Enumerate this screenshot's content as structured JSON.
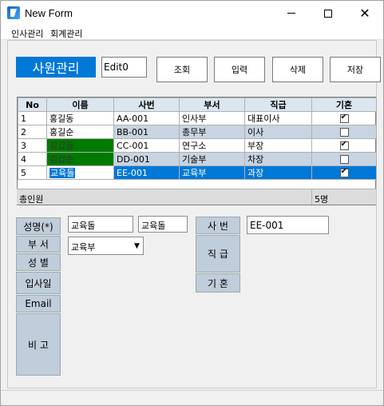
{
  "window": {
    "title": "New Form"
  },
  "menu": [
    "인사관리",
    "회계관리"
  ],
  "header": {
    "label": "사원관리",
    "edit_value": "Edit0"
  },
  "buttons": {
    "search": "조회",
    "input": "입력",
    "delete": "삭제",
    "save": "저장"
  },
  "grid": {
    "columns": [
      "No",
      "이름",
      "사번",
      "부서",
      "직급",
      "기혼"
    ],
    "rows": [
      {
        "no": "1",
        "name": "홍길동",
        "empno": "AA-001",
        "dept": "인사부",
        "rank": "대표이사",
        "married": true
      },
      {
        "no": "2",
        "name": "홍길순",
        "empno": "BB-001",
        "dept": "총무부",
        "rank": "이사",
        "married": false
      },
      {
        "no": "3",
        "name": "김갑돌",
        "empno": "CC-001",
        "dept": "연구소",
        "rank": "부장",
        "married": true
      },
      {
        "no": "4",
        "name": "김갑순",
        "empno": "DD-001",
        "dept": "기술부",
        "rank": "차장",
        "married": false
      },
      {
        "no": "5",
        "name": "교육돌",
        "empno": "EE-001",
        "dept": "교육부",
        "rank": "과장",
        "married": true
      }
    ],
    "footer_label": "총인원",
    "footer_count": "5명"
  },
  "form": {
    "labels": {
      "name": "성명(*)",
      "dept": "부 서",
      "gender": "성 별",
      "hire": "입사일",
      "email": "Email",
      "note": "비 고",
      "empno": "사 번",
      "rank": "직 급",
      "married": "기 혼"
    },
    "name_value": "교육돌",
    "name_value2": "교육돌",
    "dept_value": "교육부",
    "empno_value": "EE-001"
  },
  "colors": {
    "accent": "#0078d7",
    "alt_row": "#c7d4e2",
    "highlight": "#007a00",
    "label_bg": "#c0cdda"
  }
}
